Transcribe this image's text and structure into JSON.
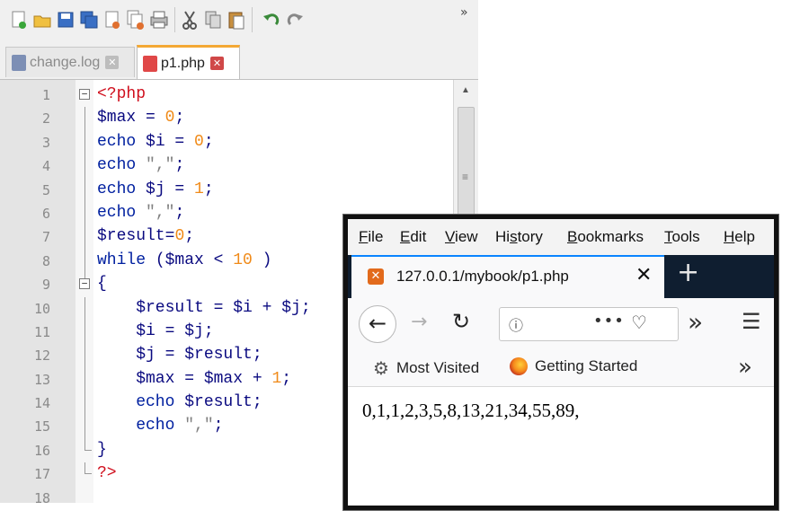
{
  "editor": {
    "toolbar": {
      "buttons": [
        "new-file-icon",
        "open-file-icon",
        "save-icon",
        "save-all-icon",
        "close-icon",
        "close-all-icon",
        "print-icon",
        "cut-icon",
        "copy-icon",
        "paste-icon",
        "undo-icon",
        "redo-icon"
      ],
      "more": "»"
    },
    "tabs": [
      {
        "label": "change.log",
        "active": false,
        "close": "✕"
      },
      {
        "label": "p1.php",
        "active": true,
        "close": "✕"
      }
    ],
    "lines": [
      {
        "n": "1",
        "fold": "box-minus"
      },
      {
        "n": "2",
        "fold": "line"
      },
      {
        "n": "3",
        "fold": "line"
      },
      {
        "n": "4",
        "fold": "line"
      },
      {
        "n": "5",
        "fold": "line"
      },
      {
        "n": "6",
        "fold": "line"
      },
      {
        "n": "7",
        "fold": "line"
      },
      {
        "n": "8",
        "fold": "line"
      },
      {
        "n": "9",
        "fold": "box-minus"
      },
      {
        "n": "10",
        "fold": "line"
      },
      {
        "n": "11",
        "fold": "line"
      },
      {
        "n": "12",
        "fold": "line"
      },
      {
        "n": "13",
        "fold": "line"
      },
      {
        "n": "14",
        "fold": "line"
      },
      {
        "n": "15",
        "fold": "line"
      },
      {
        "n": "16",
        "fold": "end"
      },
      {
        "n": "17",
        "fold": "end"
      },
      {
        "n": "18",
        "fold": "none"
      }
    ],
    "code": [
      [
        {
          "t": "<?php",
          "c": "php"
        }
      ],
      [
        {
          "t": "$max",
          "c": "var"
        },
        {
          "t": " = ",
          "c": "op"
        },
        {
          "t": "0",
          "c": "num"
        },
        {
          "t": ";",
          "c": "op"
        }
      ],
      [
        {
          "t": "echo",
          "c": "kw"
        },
        {
          "t": " $i",
          "c": "var"
        },
        {
          "t": " = ",
          "c": "op"
        },
        {
          "t": "0",
          "c": "num"
        },
        {
          "t": ";",
          "c": "op"
        }
      ],
      [
        {
          "t": "echo",
          "c": "kw"
        },
        {
          "t": " \",\"",
          "c": "str"
        },
        {
          "t": ";",
          "c": "op"
        }
      ],
      [
        {
          "t": "echo",
          "c": "kw"
        },
        {
          "t": " $j",
          "c": "var"
        },
        {
          "t": " = ",
          "c": "op"
        },
        {
          "t": "1",
          "c": "num"
        },
        {
          "t": ";",
          "c": "op"
        }
      ],
      [
        {
          "t": "echo",
          "c": "kw"
        },
        {
          "t": " \",\"",
          "c": "str"
        },
        {
          "t": ";",
          "c": "op"
        }
      ],
      [
        {
          "t": "$result",
          "c": "var"
        },
        {
          "t": "=",
          "c": "op"
        },
        {
          "t": "0",
          "c": "num"
        },
        {
          "t": ";",
          "c": "op"
        }
      ],
      [
        {
          "t": "while",
          "c": "kw"
        },
        {
          "t": " (",
          "c": "op"
        },
        {
          "t": "$max",
          "c": "var"
        },
        {
          "t": " < ",
          "c": "op"
        },
        {
          "t": "10",
          "c": "num"
        },
        {
          "t": " )",
          "c": "op"
        }
      ],
      [
        {
          "t": "{",
          "c": "op"
        }
      ],
      [
        {
          "t": "    $result",
          "c": "var"
        },
        {
          "t": " = ",
          "c": "op"
        },
        {
          "t": "$i",
          "c": "var"
        },
        {
          "t": " + ",
          "c": "op"
        },
        {
          "t": "$j",
          "c": "var"
        },
        {
          "t": ";",
          "c": "op"
        }
      ],
      [
        {
          "t": "    $i",
          "c": "var"
        },
        {
          "t": " = ",
          "c": "op"
        },
        {
          "t": "$j",
          "c": "var"
        },
        {
          "t": ";",
          "c": "op"
        }
      ],
      [
        {
          "t": "    $j",
          "c": "var"
        },
        {
          "t": " = ",
          "c": "op"
        },
        {
          "t": "$result",
          "c": "var"
        },
        {
          "t": ";",
          "c": "op"
        }
      ],
      [
        {
          "t": "    $max",
          "c": "var"
        },
        {
          "t": " = ",
          "c": "op"
        },
        {
          "t": "$max",
          "c": "var"
        },
        {
          "t": " + ",
          "c": "op"
        },
        {
          "t": "1",
          "c": "num"
        },
        {
          "t": ";",
          "c": "op"
        }
      ],
      [
        {
          "t": "    echo",
          "c": "kw"
        },
        {
          "t": " $result",
          "c": "var"
        },
        {
          "t": ";",
          "c": "op"
        }
      ],
      [
        {
          "t": "    echo",
          "c": "kw"
        },
        {
          "t": " \",\"",
          "c": "str"
        },
        {
          "t": ";",
          "c": "op"
        }
      ],
      [
        {
          "t": "}",
          "c": "op"
        }
      ],
      [
        {
          "t": "?>",
          "c": "php"
        }
      ],
      []
    ]
  },
  "firefox": {
    "menu": [
      {
        "pre": "",
        "u": "F",
        "post": "ile"
      },
      {
        "pre": "",
        "u": "E",
        "post": "dit"
      },
      {
        "pre": "",
        "u": "V",
        "post": "iew"
      },
      {
        "pre": "Hi",
        "u": "s",
        "post": "tory"
      },
      {
        "pre": "",
        "u": "B",
        "post": "ookmarks"
      },
      {
        "pre": "",
        "u": "T",
        "post": "ools"
      },
      {
        "pre": "",
        "u": "H",
        "post": "elp"
      }
    ],
    "tab": {
      "title": "127.0.0.1/mybook/p1.php",
      "close": "✕",
      "icon": "xampp-icon"
    },
    "newtab": "+",
    "nav": {
      "back": "←",
      "forward": "→",
      "reload": "↻",
      "info": "ⓘ",
      "dots": "•••",
      "pocket": "♡",
      "overflow": "»",
      "menu": "☰"
    },
    "bookmarks": [
      {
        "label": "Most Visited",
        "icon": "gear-icon"
      },
      {
        "label": "Getting Started",
        "icon": "firefox-icon"
      }
    ],
    "bookmarks_more": "»",
    "output": "0,1,1,2,3,5,8,13,21,34,55,89,"
  }
}
